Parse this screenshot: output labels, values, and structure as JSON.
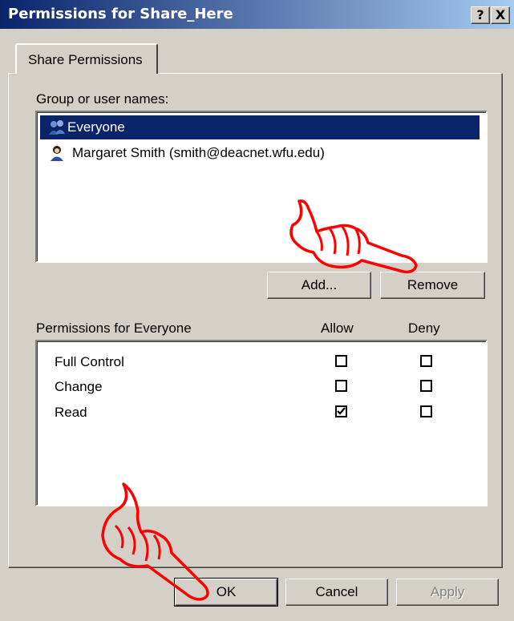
{
  "window": {
    "title": "Permissions for Share_Here",
    "help_label": "?",
    "close_label": "X"
  },
  "tabs": [
    {
      "label": "Share Permissions"
    }
  ],
  "groups": {
    "label": "Group or user names:",
    "items": [
      {
        "name": "Everyone",
        "selected": true
      },
      {
        "name": "Margaret  Smith (smith@deacnet.wfu.edu)",
        "selected": false
      }
    ],
    "add_label": "Add...",
    "remove_label": "Remove"
  },
  "permissions": {
    "label": "Permissions for Everyone",
    "allow_header": "Allow",
    "deny_header": "Deny",
    "rows": [
      {
        "name": "Full Control",
        "allow": false,
        "deny": false
      },
      {
        "name": "Change",
        "allow": false,
        "deny": false
      },
      {
        "name": "Read",
        "allow": true,
        "deny": false
      }
    ]
  },
  "footer": {
    "ok_label": "OK",
    "cancel_label": "Cancel",
    "apply_label": "Apply"
  },
  "colors": {
    "title_start": "#0a246a",
    "title_end": "#a6caf0",
    "selection": "#0a246a",
    "annotation": "#ff0000"
  },
  "icons": {
    "group": "group-users-icon",
    "user": "user-icon",
    "pointer": "pointing-hand-icon"
  }
}
